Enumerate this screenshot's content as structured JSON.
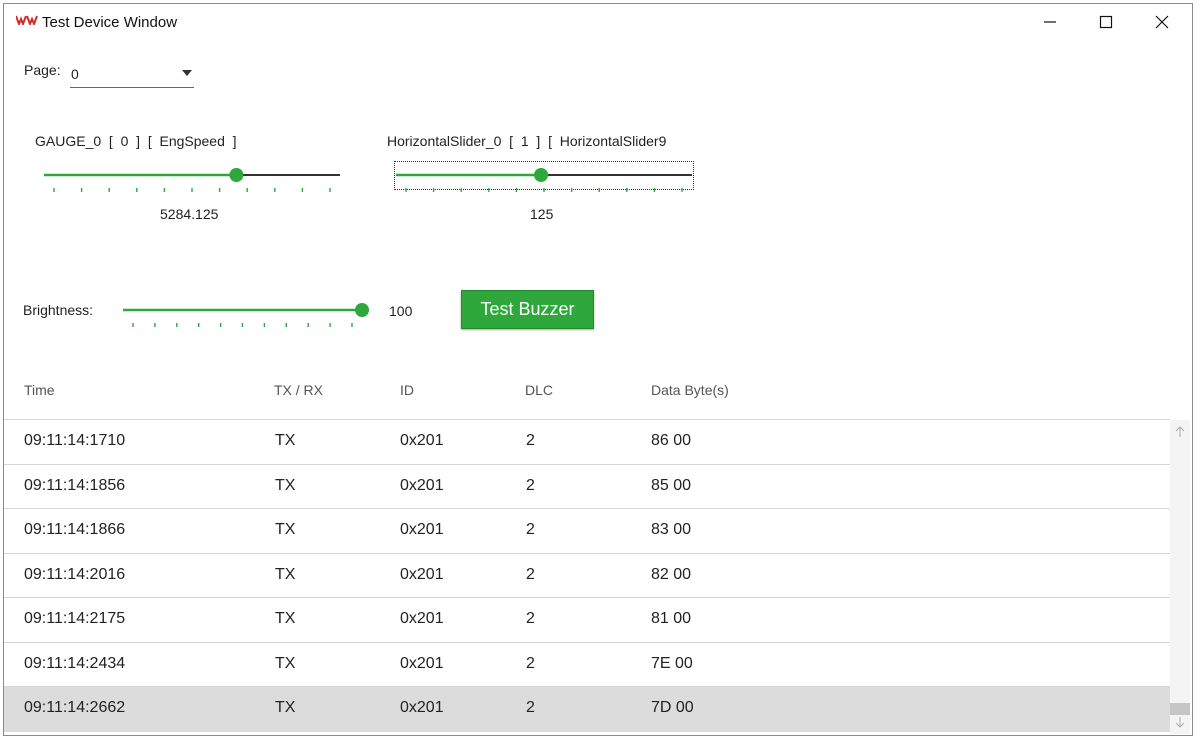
{
  "window": {
    "title": "Test Device Window"
  },
  "page_selector": {
    "label": "Page:",
    "value": "0"
  },
  "gauge": {
    "label": "GAUGE_0  [  0  ]  [  EngSpeed  ]",
    "value_text": "5284.125",
    "fill_fraction": 0.65
  },
  "horizontal_slider": {
    "label": "HorizontalSlider_0  [  1  ]  [  HorizontalSlider9",
    "value_text": "125",
    "fill_fraction": 0.49
  },
  "brightness": {
    "label": "Brightness:",
    "value_text": "100",
    "fill_fraction": 1.0
  },
  "buzzer_button": {
    "label": "Test Buzzer"
  },
  "colors": {
    "accent": "#2ea83a",
    "track": "#333333",
    "selected_row": "#dcdcdc"
  },
  "table": {
    "headers": {
      "time": "Time",
      "txrx": "TX / RX",
      "id": "ID",
      "dlc": "DLC",
      "data": "Data Byte(s)"
    },
    "rows": [
      {
        "time": "09:11:14:1710",
        "txrx": "TX",
        "id": "0x201",
        "dlc": "2",
        "data": "86 00"
      },
      {
        "time": "09:11:14:1856",
        "txrx": "TX",
        "id": "0x201",
        "dlc": "2",
        "data": "85 00"
      },
      {
        "time": "09:11:14:1866",
        "txrx": "TX",
        "id": "0x201",
        "dlc": "2",
        "data": "83 00"
      },
      {
        "time": "09:11:14:2016",
        "txrx": "TX",
        "id": "0x201",
        "dlc": "2",
        "data": "82 00"
      },
      {
        "time": "09:11:14:2175",
        "txrx": "TX",
        "id": "0x201",
        "dlc": "2",
        "data": "81 00"
      },
      {
        "time": "09:11:14:2434",
        "txrx": "TX",
        "id": "0x201",
        "dlc": "2",
        "data": "7E 00"
      },
      {
        "time": "09:11:14:2662",
        "txrx": "TX",
        "id": "0x201",
        "dlc": "2",
        "data": "7D 00"
      }
    ]
  }
}
